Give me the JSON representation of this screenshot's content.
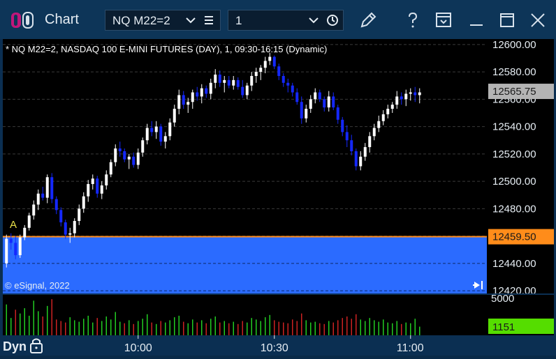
{
  "window": {
    "title": "Chart",
    "symbol": "NQ M22=2",
    "interval": "1"
  },
  "chart_data": {
    "type": "candlestick",
    "title": "* NQ M22=2, NASDAQ 100 E-MINI FUTURES (DAY), 1, 09:30-16:15 (Dynamic)",
    "watermark": "© eSignal, 2022",
    "annotation_marker": "A",
    "price_ticks": [
      "12600.00",
      "12580.00",
      "12560.00",
      "12540.00",
      "12520.00",
      "12500.00",
      "12480.00",
      "12460.00",
      "12440.00",
      "12420.00"
    ],
    "price_tick_values": [
      12600,
      12580,
      12560,
      12540,
      12520,
      12500,
      12480,
      12460,
      12440,
      12420
    ],
    "ylim": [
      12418,
      12604
    ],
    "last_price_label": "12565.75",
    "last_price": 12565.75,
    "reference_price_label": "12459.50",
    "reference_price": 12459.5,
    "time_ticks": [
      "10:00",
      "10:30",
      "11:00"
    ],
    "time_tick_values": [
      29,
      59,
      89
    ],
    "volume_scale_label": "5000",
    "volume_current_label": "1151",
    "colors": {
      "up": "#ffffff",
      "down": "#1428ff",
      "band": "#2b6bff",
      "ref_line": "#ff8c1a",
      "last_box": "#b4b4b4",
      "vol_up": "#22cc22",
      "vol_down": "#cc2222",
      "vol_box": "#55dd00"
    },
    "candles": [
      [
        12440,
        12461,
        12437,
        12458
      ],
      [
        12458,
        12462,
        12450,
        12455
      ],
      [
        12455,
        12460,
        12443,
        12446
      ],
      [
        12446,
        12461,
        12444,
        12459
      ],
      [
        12459,
        12468,
        12457,
        12466
      ],
      [
        12466,
        12477,
        12464,
        12475
      ],
      [
        12475,
        12486,
        12472,
        12483
      ],
      [
        12483,
        12494,
        12479,
        12491
      ],
      [
        12491,
        12496,
        12486,
        12488
      ],
      [
        12488,
        12505,
        12484,
        12503
      ],
      [
        12503,
        12506,
        12484,
        12487
      ],
      [
        12487,
        12489,
        12476,
        12479
      ],
      [
        12479,
        12481,
        12467,
        12470
      ],
      [
        12470,
        12472,
        12458,
        12461
      ],
      [
        12461,
        12466,
        12455,
        12462
      ],
      [
        12462,
        12473,
        12459,
        12471
      ],
      [
        12471,
        12483,
        12468,
        12480
      ],
      [
        12480,
        12492,
        12477,
        12489
      ],
      [
        12489,
        12501,
        12485,
        12498
      ],
      [
        12498,
        12505,
        12494,
        12502
      ],
      [
        12502,
        12504,
        12488,
        12491
      ],
      [
        12491,
        12500,
        12487,
        12497
      ],
      [
        12497,
        12508,
        12494,
        12505
      ],
      [
        12505,
        12516,
        12503,
        12514
      ],
      [
        12514,
        12527,
        12511,
        12524
      ],
      [
        12524,
        12529,
        12518,
        12522
      ],
      [
        12522,
        12524,
        12514,
        12516
      ],
      [
        12516,
        12520,
        12509,
        12518
      ],
      [
        12518,
        12521,
        12510,
        12512
      ],
      [
        12512,
        12524,
        12509,
        12521
      ],
      [
        12521,
        12532,
        12518,
        12530
      ],
      [
        12530,
        12542,
        12527,
        12539
      ],
      [
        12539,
        12544,
        12533,
        12536
      ],
      [
        12536,
        12544,
        12531,
        12540
      ],
      [
        12540,
        12542,
        12526,
        12529
      ],
      [
        12529,
        12536,
        12524,
        12533
      ],
      [
        12533,
        12546,
        12530,
        12543
      ],
      [
        12543,
        12556,
        12540,
        12553
      ],
      [
        12553,
        12567,
        12549,
        12563
      ],
      [
        12563,
        12566,
        12553,
        12556
      ],
      [
        12556,
        12561,
        12550,
        12558
      ],
      [
        12558,
        12567,
        12553,
        12565
      ],
      [
        12565,
        12569,
        12559,
        12562
      ],
      [
        12562,
        12571,
        12557,
        12568
      ],
      [
        12568,
        12570,
        12561,
        12564
      ],
      [
        12564,
        12575,
        12560,
        12572
      ],
      [
        12572,
        12582,
        12568,
        12578
      ],
      [
        12578,
        12581,
        12569,
        12572
      ],
      [
        12572,
        12577,
        12565,
        12574
      ],
      [
        12574,
        12577,
        12568,
        12570
      ],
      [
        12570,
        12577,
        12567,
        12574
      ],
      [
        12574,
        12576,
        12567,
        12569
      ],
      [
        12569,
        12574,
        12561,
        12563
      ],
      [
        12563,
        12572,
        12560,
        12570
      ],
      [
        12570,
        12580,
        12566,
        12577
      ],
      [
        12577,
        12583,
        12572,
        12580
      ],
      [
        12580,
        12585,
        12574,
        12583
      ],
      [
        12583,
        12591,
        12579,
        12588
      ],
      [
        12588,
        12594,
        12585,
        12591
      ],
      [
        12591,
        12592,
        12582,
        12584
      ],
      [
        12584,
        12586,
        12574,
        12577
      ],
      [
        12577,
        12579,
        12569,
        12572
      ],
      [
        12572,
        12575,
        12565,
        12570
      ],
      [
        12570,
        12572,
        12562,
        12565
      ],
      [
        12565,
        12568,
        12556,
        12558
      ],
      [
        12558,
        12562,
        12542,
        12546
      ],
      [
        12546,
        12556,
        12543,
        12553
      ],
      [
        12553,
        12563,
        12550,
        12560
      ],
      [
        12560,
        12568,
        12557,
        12565
      ],
      [
        12565,
        12567,
        12558,
        12560
      ],
      [
        12560,
        12562,
        12551,
        12554
      ],
      [
        12554,
        12566,
        12551,
        12562
      ],
      [
        12562,
        12565,
        12552,
        12554
      ],
      [
        12554,
        12556,
        12542,
        12545
      ],
      [
        12545,
        12547,
        12533,
        12536
      ],
      [
        12536,
        12541,
        12525,
        12530
      ],
      [
        12530,
        12534,
        12519,
        12522
      ],
      [
        12522,
        12524,
        12508,
        12511
      ],
      [
        12511,
        12522,
        12508,
        12518
      ],
      [
        12518,
        12528,
        12515,
        12525
      ],
      [
        12525,
        12536,
        12521,
        12533
      ],
      [
        12533,
        12542,
        12530,
        12539
      ],
      [
        12539,
        12548,
        12536,
        12544
      ],
      [
        12544,
        12552,
        12541,
        12549
      ],
      [
        12549,
        12556,
        12546,
        12553
      ],
      [
        12553,
        12558,
        12550,
        12556
      ],
      [
        12556,
        12566,
        12553,
        12562
      ],
      [
        12562,
        12565,
        12556,
        12560
      ],
      [
        12560,
        12567,
        12555,
        12564
      ],
      [
        12564,
        12568,
        12559,
        12565
      ],
      [
        12565,
        12569,
        12558,
        12563
      ],
      [
        12563,
        12568,
        12557,
        12565
      ]
    ],
    "volumes": [
      [
        4100,
        1
      ],
      [
        2300,
        1
      ],
      [
        3400,
        0
      ],
      [
        2900,
        1
      ],
      [
        3600,
        1
      ],
      [
        2600,
        1
      ],
      [
        4600,
        1
      ],
      [
        3200,
        1
      ],
      [
        2500,
        0
      ],
      [
        3900,
        1
      ],
      [
        4800,
        0
      ],
      [
        2100,
        0
      ],
      [
        1900,
        0
      ],
      [
        1700,
        0
      ],
      [
        2400,
        1
      ],
      [
        2000,
        1
      ],
      [
        1800,
        1
      ],
      [
        2200,
        1
      ],
      [
        2600,
        1
      ],
      [
        1700,
        1
      ],
      [
        2300,
        0
      ],
      [
        1900,
        1
      ],
      [
        2500,
        1
      ],
      [
        2100,
        1
      ],
      [
        3100,
        1
      ],
      [
        1800,
        1
      ],
      [
        1600,
        0
      ],
      [
        2000,
        1
      ],
      [
        1500,
        0
      ],
      [
        1900,
        1
      ],
      [
        2200,
        1
      ],
      [
        2800,
        1
      ],
      [
        1700,
        0
      ],
      [
        1500,
        1
      ],
      [
        1900,
        0
      ],
      [
        1700,
        1
      ],
      [
        2000,
        1
      ],
      [
        2400,
        1
      ],
      [
        2600,
        1
      ],
      [
        1800,
        0
      ],
      [
        1600,
        1
      ],
      [
        2100,
        1
      ],
      [
        1700,
        0
      ],
      [
        2000,
        1
      ],
      [
        1600,
        0
      ],
      [
        2200,
        1
      ],
      [
        2500,
        1
      ],
      [
        1700,
        0
      ],
      [
        1900,
        1
      ],
      [
        1600,
        0
      ],
      [
        1800,
        1
      ],
      [
        1500,
        0
      ],
      [
        1900,
        0
      ],
      [
        1700,
        1
      ],
      [
        2300,
        1
      ],
      [
        2100,
        1
      ],
      [
        1900,
        1
      ],
      [
        2400,
        1
      ],
      [
        2700,
        1
      ],
      [
        2000,
        0
      ],
      [
        1800,
        0
      ],
      [
        1700,
        0
      ],
      [
        1600,
        0
      ],
      [
        2100,
        0
      ],
      [
        1900,
        0
      ],
      [
        2900,
        0
      ],
      [
        2000,
        1
      ],
      [
        1700,
        1
      ],
      [
        1800,
        1
      ],
      [
        1600,
        0
      ],
      [
        1500,
        0
      ],
      [
        1900,
        1
      ],
      [
        1700,
        0
      ],
      [
        2000,
        0
      ],
      [
        2300,
        0
      ],
      [
        2500,
        0
      ],
      [
        2200,
        0
      ],
      [
        2800,
        0
      ],
      [
        2100,
        1
      ],
      [
        1900,
        1
      ],
      [
        2300,
        1
      ],
      [
        2000,
        1
      ],
      [
        1800,
        1
      ],
      [
        2100,
        1
      ],
      [
        1700,
        1
      ],
      [
        1600,
        1
      ],
      [
        1900,
        1
      ],
      [
        1500,
        0
      ],
      [
        1700,
        1
      ],
      [
        1600,
        1
      ],
      [
        2200,
        1
      ],
      [
        1151,
        1
      ]
    ],
    "volume_max": 5000
  }
}
